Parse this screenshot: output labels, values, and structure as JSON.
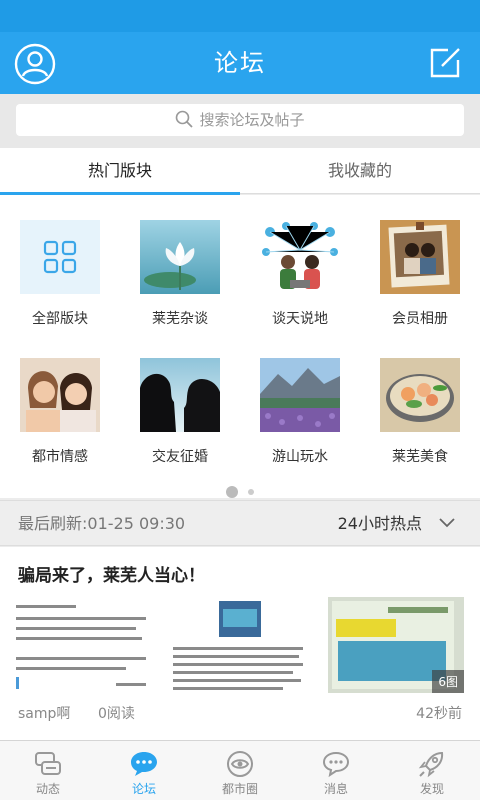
{
  "header": {
    "title": "论坛",
    "left_icon": "user-icon",
    "right_icon": "compose-icon"
  },
  "search": {
    "placeholder": "搜索论坛及帖子",
    "icon": "search-icon"
  },
  "tabs": [
    {
      "label": "热门版块",
      "active": true
    },
    {
      "label": "我收藏的",
      "active": false
    }
  ],
  "boards": [
    {
      "label": "全部版块",
      "icon": "grid-icon"
    },
    {
      "label": "莱芜杂谈"
    },
    {
      "label": "谈天说地"
    },
    {
      "label": "会员相册"
    },
    {
      "label": "都市情感"
    },
    {
      "label": "交友征婚"
    },
    {
      "label": "游山玩水"
    },
    {
      "label": "莱芜美食"
    }
  ],
  "pager": {
    "current": 1,
    "total": 2
  },
  "refresh": {
    "text": "最后刷新:01-25 09:30",
    "filter_label": "24小时热点"
  },
  "post": {
    "title": "骗局来了，莱芜人当心！",
    "image_count": "6图",
    "author": "samp啊",
    "reads": "0阅读",
    "time": "42秒前"
  },
  "bottom_nav": [
    {
      "label": "动态",
      "icon": "feed-icon",
      "active": false
    },
    {
      "label": "论坛",
      "icon": "chat-bubble-icon",
      "active": true
    },
    {
      "label": "都市圈",
      "icon": "eye-circle-icon",
      "active": false
    },
    {
      "label": "消息",
      "icon": "message-icon",
      "active": false
    },
    {
      "label": "发现",
      "icon": "rocket-icon",
      "active": false
    }
  ],
  "colors": {
    "primary": "#2aa4ee",
    "status_bar": "#1f9be6",
    "background": "#ececec"
  }
}
